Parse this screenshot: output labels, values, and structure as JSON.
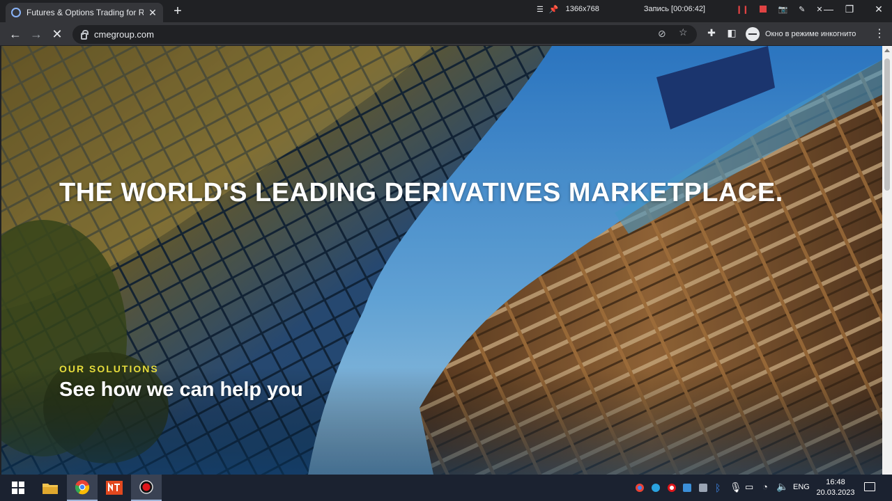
{
  "browser": {
    "tab": {
      "title": "Futures & Options Trading for Ri",
      "close": "✕"
    },
    "new_tab": "+",
    "url": "cmegroup.com",
    "incognito_label": "Окно в режиме инкогнито"
  },
  "recorder": {
    "resolution": "1366x768",
    "status": "Запись [00:06:42]"
  },
  "hero": {
    "headline": "THE WORLD'S LEADING DERIVATIVES MARKETPLACE.",
    "eyebrow": "OUR SOLUTIONS",
    "subhead": "See how we can help you"
  },
  "taskbar": {
    "language": "ENG",
    "time": "16:48",
    "date": "20.03.2023",
    "colors": {
      "chrome_red": "#ea4335",
      "chrome_green": "#34a853",
      "chrome_yellow": "#fbbc05",
      "chrome_blue": "#4285f4",
      "nt_orange": "#e2481f"
    }
  }
}
